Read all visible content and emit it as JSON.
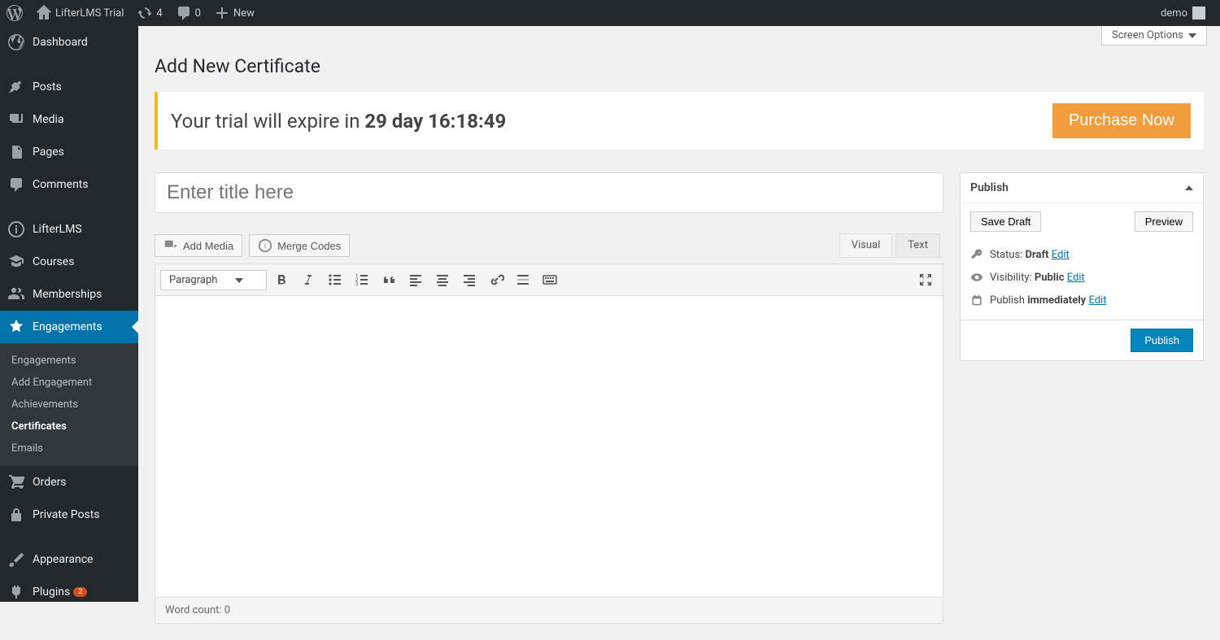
{
  "adminBar": {
    "siteName": "LifterLMS Trial",
    "updatesCount": "4",
    "commentsCount": "0",
    "newLabel": "New",
    "userGreeting": "demo"
  },
  "sidebar": {
    "dashboard": "Dashboard",
    "posts": "Posts",
    "media": "Media",
    "pages": "Pages",
    "comments": "Comments",
    "lifterLMS": "LifterLMS",
    "courses": "Courses",
    "memberships": "Memberships",
    "engagements": "Engagements",
    "orders": "Orders",
    "privatePosts": "Private Posts",
    "appearance": "Appearance",
    "plugins": "Plugins",
    "pluginsBadge": "2",
    "sub": {
      "engagements": "Engagements",
      "addEngagement": "Add Engagement",
      "achievements": "Achievements",
      "certificates": "Certificates",
      "emails": "Emails"
    }
  },
  "page": {
    "screenOptions": "Screen Options",
    "title": "Add New Certificate",
    "trialPrefix": "Your trial will expire in ",
    "trialBold": "29 day 16:18:49",
    "purchaseNow": "Purchase Now",
    "titlePlaceholder": "Enter title here"
  },
  "editor": {
    "addMedia": "Add Media",
    "mergeCodes": "Merge Codes",
    "tabVisual": "Visual",
    "tabText": "Text",
    "formatSelect": "Paragraph",
    "wordCountLabel": "Word count: ",
    "wordCountValue": "0"
  },
  "publishBox": {
    "title": "Publish",
    "saveDraft": "Save Draft",
    "preview": "Preview",
    "statusLabel": "Status: ",
    "statusValue": "Draft",
    "visibilityLabel": "Visibility: ",
    "visibilityValue": "Public",
    "publishLabel": "Publish ",
    "publishValue": "immediately",
    "editLink": "Edit",
    "publishButton": "Publish"
  }
}
